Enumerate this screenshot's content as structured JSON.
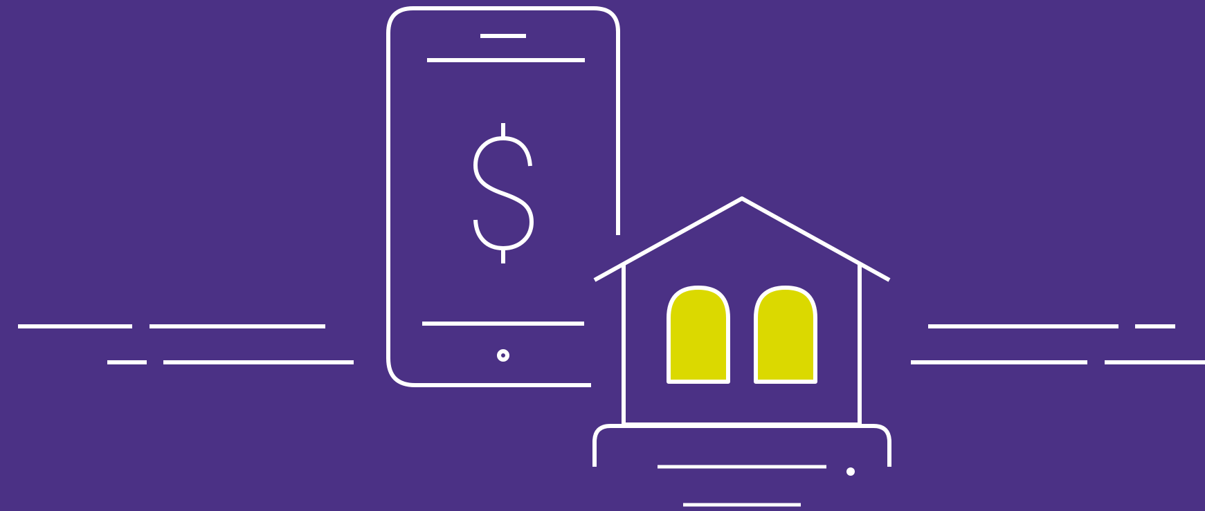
{
  "illustration": {
    "theme": "mobile banking",
    "icons": [
      "smartphone-icon",
      "dollar-sign-icon",
      "bank-building-icon",
      "speed-lines"
    ]
  },
  "colors": {
    "background": "#4b3185",
    "line": "#ffffff",
    "window_fill": "#dbd900"
  }
}
